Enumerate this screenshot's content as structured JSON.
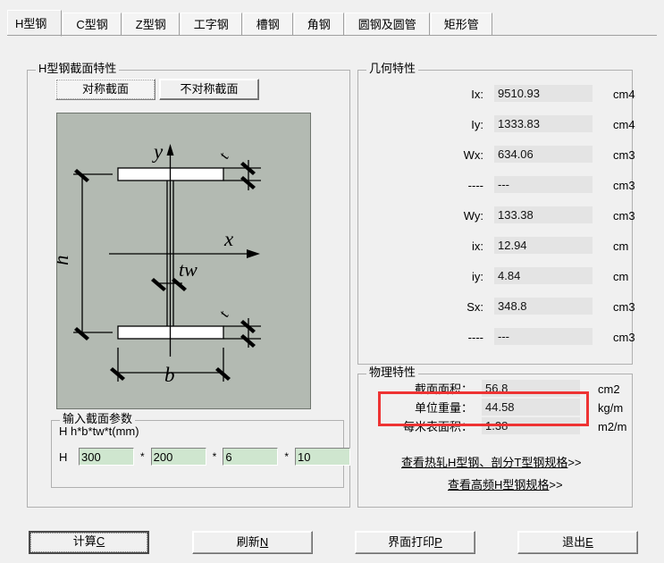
{
  "tabs": [
    {
      "label": "H型钢",
      "selected": true
    },
    {
      "label": "C型钢",
      "selected": false
    },
    {
      "label": "Z型钢",
      "selected": false
    },
    {
      "label": "工字钢",
      "selected": false
    },
    {
      "label": "槽钢",
      "selected": false
    },
    {
      "label": "角钢",
      "selected": false
    },
    {
      "label": "圆钢及圆管",
      "selected": false
    },
    {
      "label": "矩形管",
      "selected": false
    }
  ],
  "section_group": {
    "title": "H型钢截面特性",
    "symmetric_button": "对称截面",
    "asymmetric_button": "不对称截面"
  },
  "diagram": {
    "label_y": "y",
    "label_x": "x",
    "label_h": "h",
    "label_b": "b",
    "label_tw": "tw",
    "label_t1": "t",
    "label_t2": "t",
    "background_color": "#b3bab2"
  },
  "input_group": {
    "title": "输入截面参数",
    "hint": "H   h*b*tw*t(mm)",
    "prefix": "H",
    "separator": "*",
    "fields": [
      {
        "name": "h",
        "value": "300"
      },
      {
        "name": "b",
        "value": "200"
      },
      {
        "name": "tw",
        "value": "6"
      },
      {
        "name": "t",
        "value": "10"
      }
    ]
  },
  "geometry_group": {
    "title": "几何特性",
    "rows": [
      {
        "label": "Ix:",
        "value": "9510.93",
        "unit": "cm4"
      },
      {
        "label": "Iy:",
        "value": "1333.83",
        "unit": "cm4"
      },
      {
        "label": "Wx:",
        "value": "634.06",
        "unit": "cm3"
      },
      {
        "label": "----",
        "value": "---",
        "unit": "cm3"
      },
      {
        "label": "Wy:",
        "value": "133.38",
        "unit": "cm3"
      },
      {
        "label": "ix:",
        "value": "12.94",
        "unit": "cm"
      },
      {
        "label": "iy:",
        "value": "4.84",
        "unit": "cm"
      },
      {
        "label": "Sx:",
        "value": "348.8",
        "unit": "cm3"
      },
      {
        "label": "----",
        "value": "---",
        "unit": "cm3"
      }
    ]
  },
  "physical_group": {
    "title": "物理特性",
    "rows": [
      {
        "label": "截面面积：",
        "value": "56.8",
        "unit": "cm2"
      },
      {
        "label": "单位重量：",
        "value": "44.58",
        "unit": "kg/m"
      },
      {
        "label": "每米表面积：",
        "value": "1.38",
        "unit": "m2/m"
      }
    ],
    "highlight_color": "#ee3333",
    "links": [
      {
        "text": "查看热轧H型钢、剖分T型钢规格",
        "suffix": ">>"
      },
      {
        "text": "查看高频H型钢规格",
        "suffix": ">>"
      }
    ]
  },
  "buttons": {
    "calculate": {
      "text": "计算",
      "accel": "C"
    },
    "refresh": {
      "text": "刷新",
      "accel": "N"
    },
    "print": {
      "text": "界面打印",
      "accel": "P"
    },
    "exit": {
      "text": "退出",
      "accel": "E"
    }
  }
}
